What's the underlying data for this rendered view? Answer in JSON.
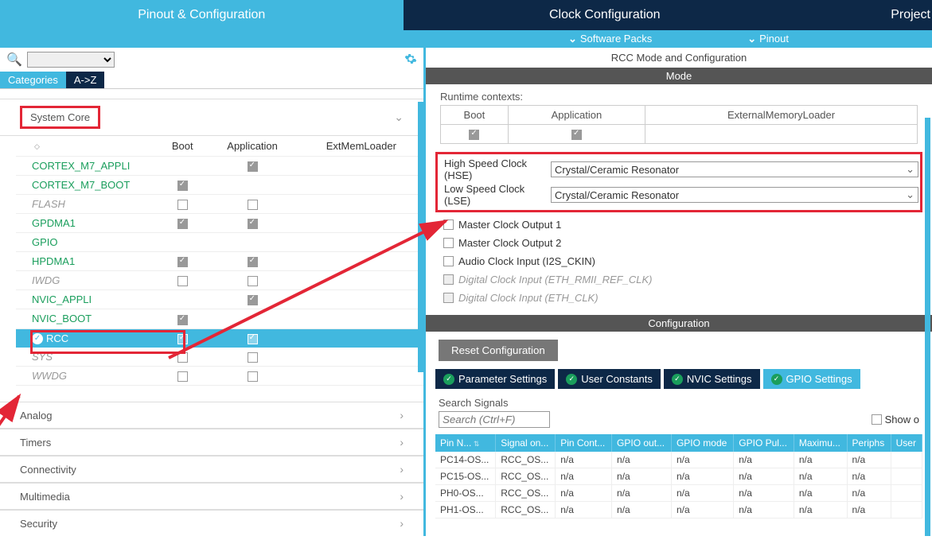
{
  "tabs": {
    "pinout": "Pinout & Configuration",
    "clock": "Clock Configuration",
    "project": "Project"
  },
  "subTabs": {
    "software": "Software Packs",
    "pinout": "Pinout"
  },
  "filterTabs": {
    "categories": "Categories",
    "az": "A->Z"
  },
  "categories": {
    "systemCore": "System Core",
    "analog": "Analog",
    "timers": "Timers",
    "connectivity": "Connectivity",
    "multimedia": "Multimedia",
    "security": "Security"
  },
  "coreHeaders": {
    "boot": "Boot",
    "app": "Application",
    "ext": "ExtMemLoader"
  },
  "coreItems": [
    {
      "name": "CORTEX_M7_APPLI",
      "cls": "green-text",
      "boot": false,
      "app": true,
      "showBoot": false,
      "showApp": true
    },
    {
      "name": "CORTEX_M7_BOOT",
      "cls": "green-text",
      "boot": true,
      "app": false,
      "showBoot": true,
      "showApp": false
    },
    {
      "name": "FLASH",
      "cls": "gray-italic",
      "boot": false,
      "app": false,
      "showBoot": true,
      "showApp": true
    },
    {
      "name": "GPDMA1",
      "cls": "green-text",
      "boot": true,
      "app": true,
      "showBoot": true,
      "showApp": true
    },
    {
      "name": "GPIO",
      "cls": "green-text",
      "boot": false,
      "app": false,
      "showBoot": false,
      "showApp": false
    },
    {
      "name": "HPDMA1",
      "cls": "green-text",
      "boot": true,
      "app": true,
      "showBoot": true,
      "showApp": true
    },
    {
      "name": "IWDG",
      "cls": "gray-italic",
      "boot": false,
      "app": false,
      "showBoot": true,
      "showApp": true
    },
    {
      "name": "NVIC_APPLI",
      "cls": "green-text",
      "boot": false,
      "app": true,
      "showBoot": false,
      "showApp": true
    },
    {
      "name": "NVIC_BOOT",
      "cls": "green-text",
      "boot": true,
      "app": false,
      "showBoot": true,
      "showApp": false
    },
    {
      "name": "RCC",
      "cls": "selected",
      "boot": true,
      "app": true,
      "showBoot": true,
      "showApp": true
    },
    {
      "name": "SYS",
      "cls": "gray-italic",
      "boot": false,
      "app": false,
      "showBoot": true,
      "showApp": true
    },
    {
      "name": "WWDG",
      "cls": "gray-italic",
      "boot": false,
      "app": false,
      "showBoot": true,
      "showApp": true
    }
  ],
  "right": {
    "title": "RCC Mode and Configuration",
    "mode": "Mode",
    "configuration": "Configuration",
    "runtimeLabel": "Runtime contexts:",
    "rtHeaders": {
      "boot": "Boot",
      "app": "Application",
      "ext": "ExternalMemoryLoader"
    },
    "hseLabel": "High Speed Clock (HSE)",
    "hseValue": "Crystal/Ceramic Resonator",
    "lseLabel": "Low Speed Clock (LSE)",
    "lseValue": "Crystal/Ceramic Resonator",
    "mco1": "Master Clock Output 1",
    "mco2": "Master Clock Output 2",
    "audio": "Audio Clock Input (I2S_CKIN)",
    "eth1": "Digital Clock Input (ETH_RMII_REF_CLK)",
    "eth2": "Digital Clock Input (ETH_CLK)",
    "reset": "Reset Configuration",
    "cfgTabs": {
      "param": "Parameter Settings",
      "user": "User Constants",
      "nvic": "NVIC Settings",
      "gpio": "GPIO Settings"
    },
    "searchLabel": "Search Signals",
    "searchPlaceholder": "Search (Ctrl+F)",
    "showOnly": "Show o",
    "gpioHeaders": [
      "Pin N...",
      "Signal on...",
      "Pin Cont...",
      "GPIO out...",
      "GPIO mode",
      "GPIO Pul...",
      "Maximu...",
      "Periphs",
      "User"
    ],
    "gpioRows": [
      {
        "pin": "PC14-OS...",
        "signal": "RCC_OS...",
        "c3": "n/a",
        "c4": "n/a",
        "c5": "n/a",
        "c6": "n/a",
        "c7": "n/a",
        "c8": "n/a",
        "c9": ""
      },
      {
        "pin": "PC15-OS...",
        "signal": "RCC_OS...",
        "c3": "n/a",
        "c4": "n/a",
        "c5": "n/a",
        "c6": "n/a",
        "c7": "n/a",
        "c8": "n/a",
        "c9": ""
      },
      {
        "pin": "PH0-OS...",
        "signal": "RCC_OS...",
        "c3": "n/a",
        "c4": "n/a",
        "c5": "n/a",
        "c6": "n/a",
        "c7": "n/a",
        "c8": "n/a",
        "c9": ""
      },
      {
        "pin": "PH1-OS...",
        "signal": "RCC_OS...",
        "c3": "n/a",
        "c4": "n/a",
        "c5": "n/a",
        "c6": "n/a",
        "c7": "n/a",
        "c8": "n/a",
        "c9": ""
      }
    ]
  }
}
